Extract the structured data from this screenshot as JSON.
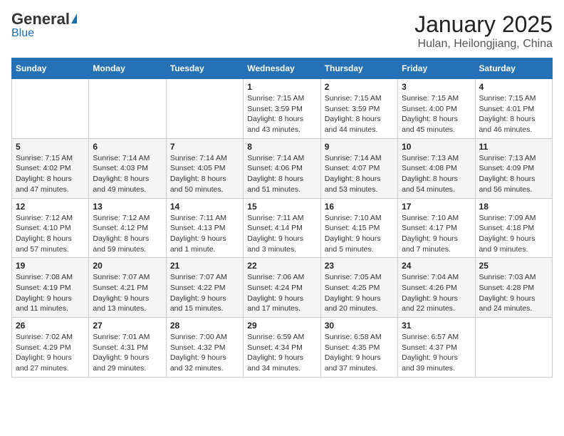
{
  "header": {
    "logo_general": "General",
    "logo_blue": "Blue",
    "title": "January 2025",
    "subtitle": "Hulan, Heilongjiang, China"
  },
  "weekdays": [
    "Sunday",
    "Monday",
    "Tuesday",
    "Wednesday",
    "Thursday",
    "Friday",
    "Saturday"
  ],
  "weeks": [
    [
      {
        "day": "",
        "info": ""
      },
      {
        "day": "",
        "info": ""
      },
      {
        "day": "",
        "info": ""
      },
      {
        "day": "1",
        "info": "Sunrise: 7:15 AM\nSunset: 3:59 PM\nDaylight: 8 hours and 43 minutes."
      },
      {
        "day": "2",
        "info": "Sunrise: 7:15 AM\nSunset: 3:59 PM\nDaylight: 8 hours and 44 minutes."
      },
      {
        "day": "3",
        "info": "Sunrise: 7:15 AM\nSunset: 4:00 PM\nDaylight: 8 hours and 45 minutes."
      },
      {
        "day": "4",
        "info": "Sunrise: 7:15 AM\nSunset: 4:01 PM\nDaylight: 8 hours and 46 minutes."
      }
    ],
    [
      {
        "day": "5",
        "info": "Sunrise: 7:15 AM\nSunset: 4:02 PM\nDaylight: 8 hours and 47 minutes."
      },
      {
        "day": "6",
        "info": "Sunrise: 7:14 AM\nSunset: 4:03 PM\nDaylight: 8 hours and 49 minutes."
      },
      {
        "day": "7",
        "info": "Sunrise: 7:14 AM\nSunset: 4:05 PM\nDaylight: 8 hours and 50 minutes."
      },
      {
        "day": "8",
        "info": "Sunrise: 7:14 AM\nSunset: 4:06 PM\nDaylight: 8 hours and 51 minutes."
      },
      {
        "day": "9",
        "info": "Sunrise: 7:14 AM\nSunset: 4:07 PM\nDaylight: 8 hours and 53 minutes."
      },
      {
        "day": "10",
        "info": "Sunrise: 7:13 AM\nSunset: 4:08 PM\nDaylight: 8 hours and 54 minutes."
      },
      {
        "day": "11",
        "info": "Sunrise: 7:13 AM\nSunset: 4:09 PM\nDaylight: 8 hours and 56 minutes."
      }
    ],
    [
      {
        "day": "12",
        "info": "Sunrise: 7:12 AM\nSunset: 4:10 PM\nDaylight: 8 hours and 57 minutes."
      },
      {
        "day": "13",
        "info": "Sunrise: 7:12 AM\nSunset: 4:12 PM\nDaylight: 8 hours and 59 minutes."
      },
      {
        "day": "14",
        "info": "Sunrise: 7:11 AM\nSunset: 4:13 PM\nDaylight: 9 hours and 1 minute."
      },
      {
        "day": "15",
        "info": "Sunrise: 7:11 AM\nSunset: 4:14 PM\nDaylight: 9 hours and 3 minutes."
      },
      {
        "day": "16",
        "info": "Sunrise: 7:10 AM\nSunset: 4:15 PM\nDaylight: 9 hours and 5 minutes."
      },
      {
        "day": "17",
        "info": "Sunrise: 7:10 AM\nSunset: 4:17 PM\nDaylight: 9 hours and 7 minutes."
      },
      {
        "day": "18",
        "info": "Sunrise: 7:09 AM\nSunset: 4:18 PM\nDaylight: 9 hours and 9 minutes."
      }
    ],
    [
      {
        "day": "19",
        "info": "Sunrise: 7:08 AM\nSunset: 4:19 PM\nDaylight: 9 hours and 11 minutes."
      },
      {
        "day": "20",
        "info": "Sunrise: 7:07 AM\nSunset: 4:21 PM\nDaylight: 9 hours and 13 minutes."
      },
      {
        "day": "21",
        "info": "Sunrise: 7:07 AM\nSunset: 4:22 PM\nDaylight: 9 hours and 15 minutes."
      },
      {
        "day": "22",
        "info": "Sunrise: 7:06 AM\nSunset: 4:24 PM\nDaylight: 9 hours and 17 minutes."
      },
      {
        "day": "23",
        "info": "Sunrise: 7:05 AM\nSunset: 4:25 PM\nDaylight: 9 hours and 20 minutes."
      },
      {
        "day": "24",
        "info": "Sunrise: 7:04 AM\nSunset: 4:26 PM\nDaylight: 9 hours and 22 minutes."
      },
      {
        "day": "25",
        "info": "Sunrise: 7:03 AM\nSunset: 4:28 PM\nDaylight: 9 hours and 24 minutes."
      }
    ],
    [
      {
        "day": "26",
        "info": "Sunrise: 7:02 AM\nSunset: 4:29 PM\nDaylight: 9 hours and 27 minutes."
      },
      {
        "day": "27",
        "info": "Sunrise: 7:01 AM\nSunset: 4:31 PM\nDaylight: 9 hours and 29 minutes."
      },
      {
        "day": "28",
        "info": "Sunrise: 7:00 AM\nSunset: 4:32 PM\nDaylight: 9 hours and 32 minutes."
      },
      {
        "day": "29",
        "info": "Sunrise: 6:59 AM\nSunset: 4:34 PM\nDaylight: 9 hours and 34 minutes."
      },
      {
        "day": "30",
        "info": "Sunrise: 6:58 AM\nSunset: 4:35 PM\nDaylight: 9 hours and 37 minutes."
      },
      {
        "day": "31",
        "info": "Sunrise: 6:57 AM\nSunset: 4:37 PM\nDaylight: 9 hours and 39 minutes."
      },
      {
        "day": "",
        "info": ""
      }
    ]
  ]
}
